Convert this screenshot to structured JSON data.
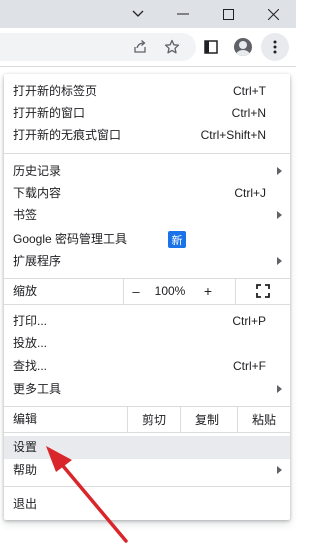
{
  "window": {
    "minimize_icon": "chevron-down-icon",
    "minimize": "—",
    "restore": "□",
    "close": "✕"
  },
  "toolbar": {
    "icons": [
      "share-icon",
      "bookmark-star-icon",
      "side-panel-icon",
      "profile-icon",
      "menu-kebab-icon"
    ]
  },
  "menu": {
    "new_tab": {
      "label": "打开新的标签页",
      "shortcut": "Ctrl+T"
    },
    "new_window": {
      "label": "打开新的窗口",
      "shortcut": "Ctrl+N"
    },
    "new_incognito": {
      "label": "打开新的无痕式窗口",
      "shortcut": "Ctrl+Shift+N"
    },
    "history": {
      "label": "历史记录"
    },
    "downloads": {
      "label": "下载内容",
      "shortcut": "Ctrl+J"
    },
    "bookmarks": {
      "label": "书签"
    },
    "password_manager": {
      "label": "Google 密码管理工具",
      "badge": "新"
    },
    "extensions": {
      "label": "扩展程序"
    },
    "zoom": {
      "label": "缩放",
      "minus": "–",
      "value": "100%",
      "plus": "+"
    },
    "print": {
      "label": "打印...",
      "shortcut": "Ctrl+P"
    },
    "cast": {
      "label": "投放..."
    },
    "find": {
      "label": "查找...",
      "shortcut": "Ctrl+F"
    },
    "more_tools": {
      "label": "更多工具"
    },
    "edit": {
      "label": "编辑",
      "cut": "剪切",
      "copy": "复制",
      "paste": "粘贴"
    },
    "settings": {
      "label": "设置"
    },
    "help": {
      "label": "帮助"
    },
    "exit": {
      "label": "退出"
    }
  },
  "colors": {
    "accent": "#1a73e8",
    "highlight": "#e8eaed",
    "annotation_arrow": "#d8262b"
  }
}
